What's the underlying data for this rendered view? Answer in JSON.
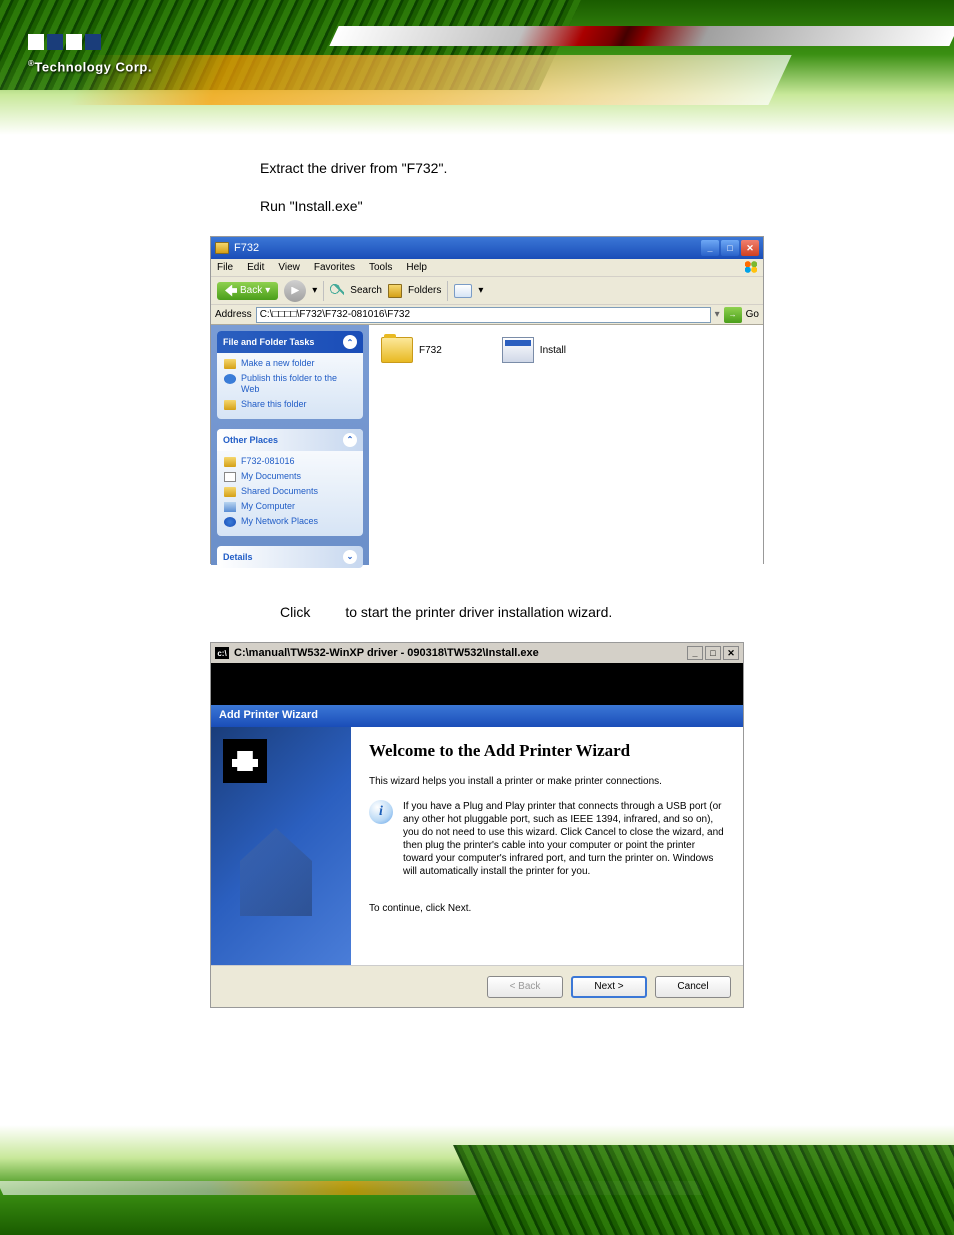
{
  "header": {
    "brand": "Technology Corp.",
    "reg": "®"
  },
  "steps": {
    "s1": "Extract the driver from \"F732\".",
    "s2": "Run \"Install.exe\"",
    "s3a": "Click",
    "s3b": "to start the printer driver installation wizard."
  },
  "explorer": {
    "title": "F732",
    "menu": {
      "file": "File",
      "edit": "Edit",
      "view": "View",
      "favorites": "Favorites",
      "tools": "Tools",
      "help": "Help"
    },
    "toolbar": {
      "back": "Back",
      "search": "Search",
      "folders": "Folders"
    },
    "address_label": "Address",
    "address_value": "C:\\□□□□\\F732\\F732-081016\\F732",
    "go": "Go",
    "tasks": {
      "hdr": "File and Folder Tasks",
      "items": [
        "Make a new folder",
        "Publish this folder to the Web",
        "Share this folder"
      ]
    },
    "places": {
      "hdr": "Other Places",
      "items": [
        "F732-081016",
        "My Documents",
        "Shared Documents",
        "My Computer",
        "My Network Places"
      ]
    },
    "details": {
      "hdr": "Details"
    },
    "files": {
      "folder": "F732",
      "exe": "Install"
    }
  },
  "cmd": {
    "title": "C:\\manual\\TW532-WinXP driver - 090318\\TW532\\Install.exe"
  },
  "wizard": {
    "bar": "Add Printer Wizard",
    "heading": "Welcome to the Add Printer Wizard",
    "intro": "This wizard helps you install a printer or make printer connections.",
    "info": "If you have a Plug and Play printer that connects through a USB port (or any other hot pluggable port, such as IEEE 1394, infrared, and so on), you do not need to use this wizard. Click Cancel to close the wizard, and then plug the printer's cable into your computer or point the printer toward your computer's infrared port, and turn the printer on. Windows will automatically install the printer for you.",
    "cont": "To continue, click Next.",
    "back": "< Back",
    "next": "Next >",
    "cancel": "Cancel"
  }
}
